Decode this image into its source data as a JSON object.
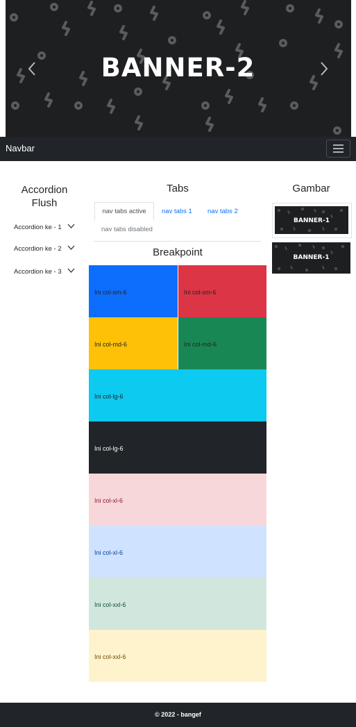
{
  "carousel": {
    "slide_title": "BANNER-2",
    "prev_icon": "chevron-left-icon",
    "next_icon": "chevron-right-icon"
  },
  "navbar": {
    "brand": "Navbar",
    "toggler_icon": "hamburger-icon"
  },
  "accordion": {
    "heading_line1": "Accordion",
    "heading_line2": "Flush",
    "items": [
      {
        "label": "Accordion ke - 1"
      },
      {
        "label": "Accordion ke - 2"
      },
      {
        "label": "Accordion ke - 3"
      }
    ]
  },
  "tabs": {
    "heading": "Tabs",
    "items": [
      {
        "label": "nav tabs active",
        "state": "active"
      },
      {
        "label": "nav tabs 1",
        "state": "link"
      },
      {
        "label": "nav tabs 2",
        "state": "link"
      },
      {
        "label": "nav tabs disabled",
        "state": "disabled"
      }
    ]
  },
  "breakpoint": {
    "heading": "Breakpoint",
    "cells": [
      {
        "label": "Ini col-sm-6",
        "color": "#0d6efd"
      },
      {
        "label": "Ini col-sm-6",
        "color": "#dc3545"
      },
      {
        "label": "Ini col-md-6",
        "color": "#ffc107"
      },
      {
        "label": "Ini col-md-6",
        "color": "#198754"
      },
      {
        "label": "Ini col-lg-6",
        "color": "#0dcaf0"
      },
      {
        "label": "Ini col-lg-6",
        "color": "#212529"
      },
      {
        "label": "Ini col-xl-6",
        "color": "#f8d7da"
      },
      {
        "label": "Ini col-xl-6",
        "color": "#cfe2ff"
      },
      {
        "label": "Ini col-xxl-6",
        "color": "#d1e7dd"
      },
      {
        "label": "Ini col-xxl-6",
        "color": "#fff3cd"
      }
    ]
  },
  "gallery": {
    "heading": "Gambar",
    "images": [
      {
        "text": "BANNER-1"
      },
      {
        "text": "BANNER-1"
      }
    ]
  },
  "footer": {
    "text": "© 2022 - bangef"
  }
}
